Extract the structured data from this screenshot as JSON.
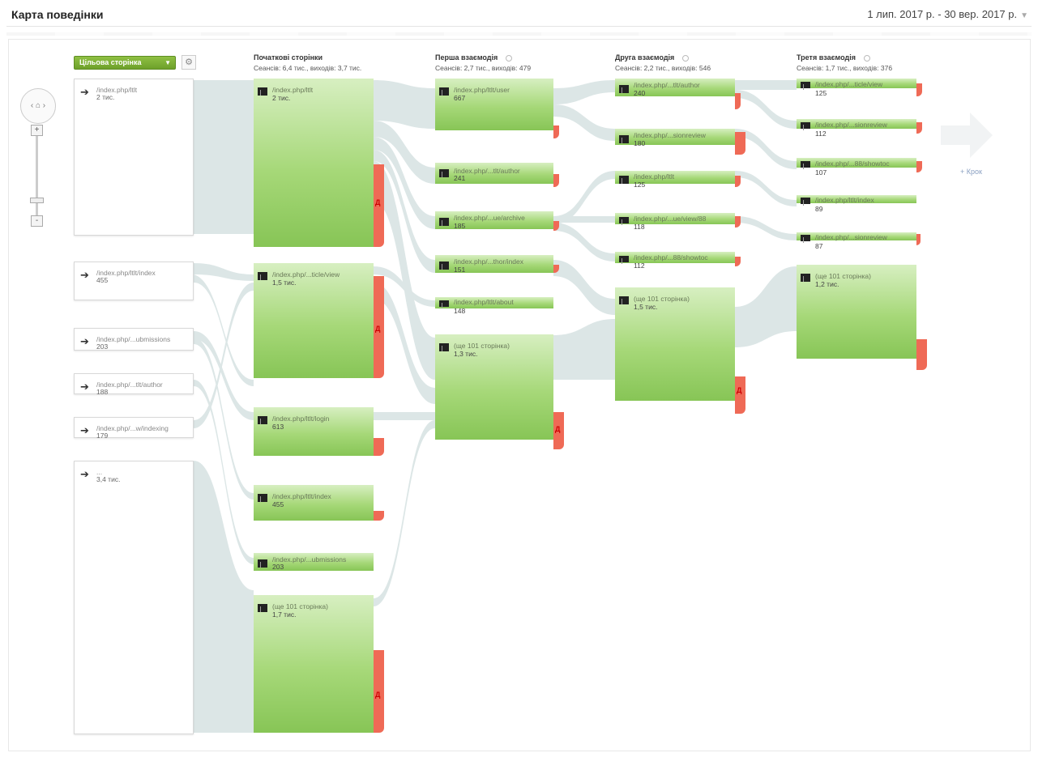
{
  "page": {
    "title": "Карта поведінки",
    "date_range": "1 лип. 2017 р. - 30 вер. 2017 р."
  },
  "toolbar": {
    "dimension": "Цільова сторінка",
    "home_label": "‹ ⌂ ›",
    "zoom_in": "+",
    "zoom_out": "-"
  },
  "columns": [
    {
      "name": "Початкові сторінки",
      "stats": "Сеансів: 6,4 тис., виходів: 3,7 тис."
    },
    {
      "name": "Перша взаємодія",
      "stats": "Сеансів: 2,7 тис., виходів: 479"
    },
    {
      "name": "Друга взаємодія",
      "stats": "Сеансів: 2,2 тис., виходів: 546"
    },
    {
      "name": "Третя взаємодія",
      "stats": "Сеансів: 1,7 тис., виходів: 376"
    }
  ],
  "sources": [
    {
      "label": "/index.php/ltlt",
      "value": "2 тис."
    },
    {
      "label": "/index.php/ltlt/index",
      "value": "455"
    },
    {
      "label": "/index.php/...ubmissions",
      "value": "203"
    },
    {
      "label": "/index.php/...tlt/author",
      "value": "188"
    },
    {
      "label": "/index.php/...w/indexing",
      "value": "179"
    },
    {
      "label": "...",
      "value": "3,4 тис."
    }
  ],
  "start_pages": [
    {
      "label": "/index.php/ltlt",
      "value": "2 тис."
    },
    {
      "label": "/index.php/...ticle/view",
      "value": "1,5 тис."
    },
    {
      "label": "/index.php/ltlt/login",
      "value": "613"
    },
    {
      "label": "/index.php/ltlt/index",
      "value": "455"
    },
    {
      "label": "/index.php/...ubmissions",
      "value": "203"
    },
    {
      "label": "(ще 101 сторінка)",
      "value": "1,7 тис."
    }
  ],
  "first_interaction": [
    {
      "label": "/index.php/ltlt/user",
      "value": "667"
    },
    {
      "label": "/index.php/...tlt/author",
      "value": "241"
    },
    {
      "label": "/index.php/...ue/archive",
      "value": "185"
    },
    {
      "label": "/index.php/...thor/index",
      "value": "151"
    },
    {
      "label": "/index.php/ltlt/about",
      "value": "148"
    },
    {
      "label": "(ще 101 сторінка)",
      "value": "1,3 тис."
    }
  ],
  "second_interaction": [
    {
      "label": "/index.php/...tlt/author",
      "value": "240"
    },
    {
      "label": "/index.php/...sionreview",
      "value": "180"
    },
    {
      "label": "/index.php/ltlt",
      "value": "125"
    },
    {
      "label": "/index.php/...ue/view/88",
      "value": "118"
    },
    {
      "label": "/index.php/...88/showtoc",
      "value": "112"
    },
    {
      "label": "(ще 101 сторінка)",
      "value": "1,5 тис."
    }
  ],
  "third_interaction": [
    {
      "label": "/index.php/...ticle/view",
      "value": "125"
    },
    {
      "label": "/index.php/...sionreview",
      "value": "112"
    },
    {
      "label": "/index.php/...88/showtoc",
      "value": "107"
    },
    {
      "label": "/index.php/ltlt/index",
      "value": "89"
    },
    {
      "label": "/index.php/...sionreview",
      "value": "87"
    },
    {
      "label": "(ще 101 сторінка)",
      "value": "1,2 тис."
    }
  ],
  "drop_marker": "Д",
  "next_step": "+ Крок",
  "colors": {
    "node_green": "#87c556",
    "drop_red": "#ef6a56",
    "flow_gray": "#d6e2e2"
  }
}
